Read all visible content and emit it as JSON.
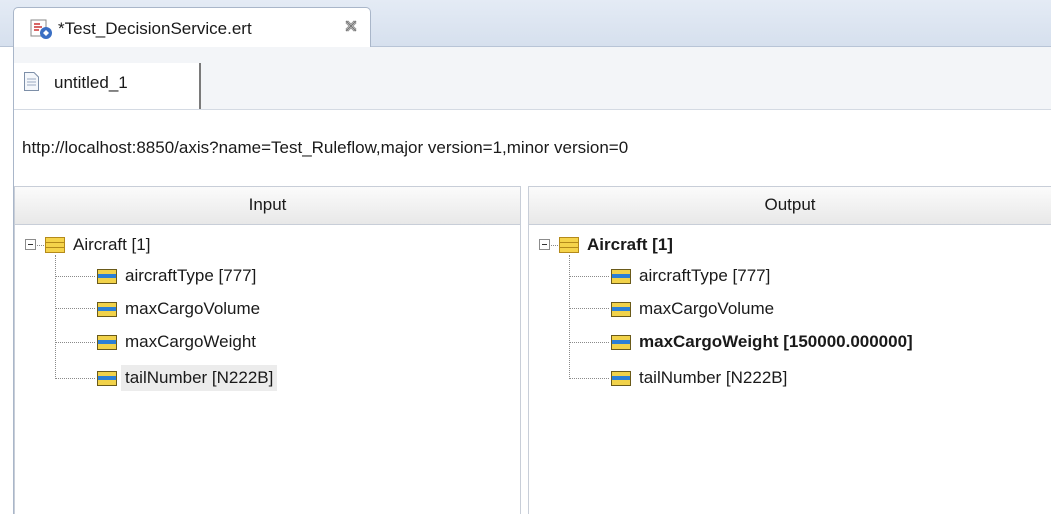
{
  "editor": {
    "tab_title": "*Test_DecisionService.ert"
  },
  "subtab": {
    "label": "untitled_1"
  },
  "url": "http://localhost:8850/axis?name=Test_Ruleflow,major version=1,minor version=0",
  "input_panel": {
    "header": "Input",
    "root_label": "Aircraft [1]",
    "children": [
      {
        "label": "aircraftType [777]"
      },
      {
        "label": "maxCargoVolume"
      },
      {
        "label": "maxCargoWeight"
      },
      {
        "label": "tailNumber [N222B]"
      }
    ]
  },
  "output_panel": {
    "header": "Output",
    "root_label": "Aircraft [1]",
    "children": [
      {
        "label": "aircraftType [777]"
      },
      {
        "label": "maxCargoVolume"
      },
      {
        "label": "maxCargoWeight [150000.000000]"
      },
      {
        "label": "tailNumber [N222B]"
      }
    ]
  },
  "icons": {
    "editor_tab_icon": "decision-service-icon",
    "close_icon": "close-icon",
    "subtab_icon": "document-icon",
    "entity_icon": "entity-icon",
    "attribute_icon": "attribute-icon",
    "collapse_icon": "collapse-icon"
  },
  "colors": {
    "tab_strip": "#d6e0ee",
    "entity_icon": "#f5d34a",
    "attribute_icon_stripe": "#2b7fd6",
    "selected_row": "#ececec"
  }
}
